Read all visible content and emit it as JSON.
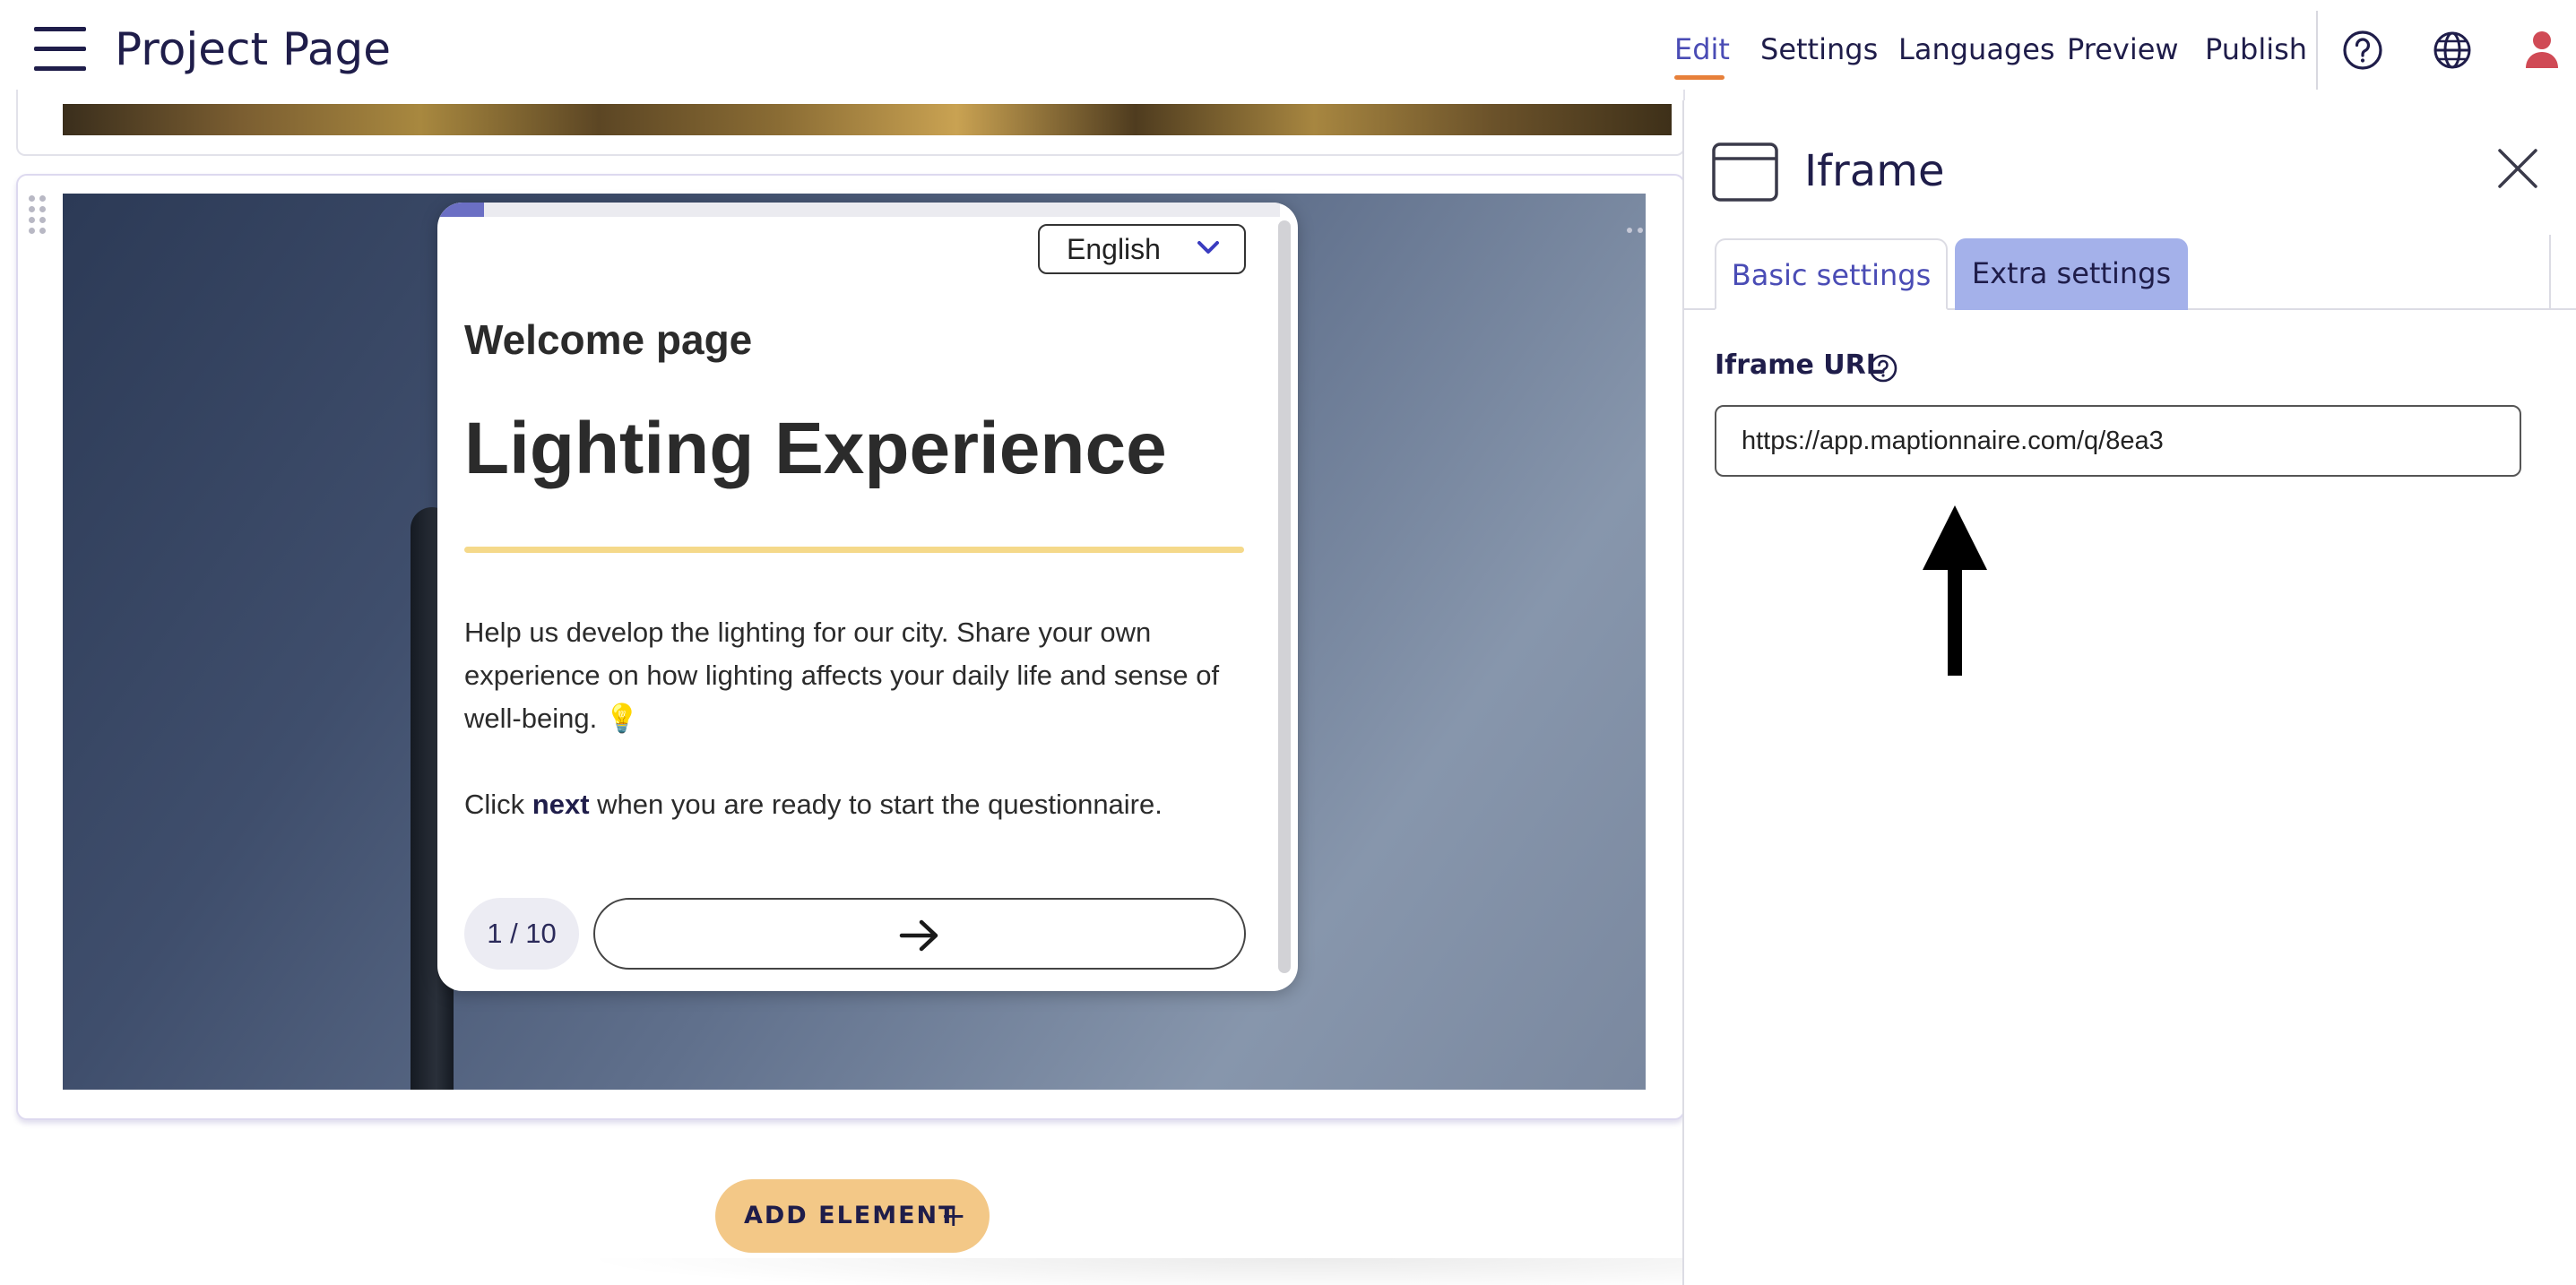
{
  "header": {
    "title": "Project Page",
    "nav": [
      "Edit",
      "Settings",
      "Languages",
      "Preview",
      "Publish"
    ],
    "active_nav": "Edit",
    "icons": [
      "help-icon",
      "globe-icon",
      "user-icon"
    ],
    "accent_color": "#4a4cb5",
    "active_underline_color": "#e7803a",
    "user_icon_color": "#d04a55"
  },
  "questionnaire": {
    "language": "English",
    "welcome": "Welcome page",
    "title": "Lighting Experience",
    "intro": "Help us develop the lighting for our city. Share your own experience on how lighting affects your daily life and sense of well-being. 💡",
    "instruction_prefix": "Click ",
    "instruction_bold": "next",
    "instruction_suffix": " when you are ready to start the questionnaire.",
    "page_indicator": "1 / 10",
    "progress_fraction": 0.055,
    "divider_color": "#f5d98a"
  },
  "canvas": {
    "add_element_label": "ADD ELEMENT",
    "add_element_color": "#f3c887"
  },
  "panel": {
    "title": "Iframe",
    "tabs": [
      "Basic settings",
      "Extra settings"
    ],
    "active_tab": "Basic settings",
    "field_label": "Iframe URL",
    "url_value": "https://app.maptionnaire.com/q/8ea3",
    "extra_tab_color": "#a4b1ea"
  }
}
